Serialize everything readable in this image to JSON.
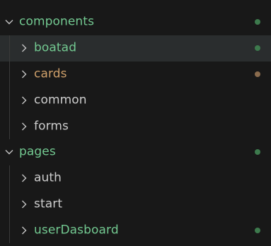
{
  "colors": {
    "background": "#181818",
    "selected_row": "#2a2d2e",
    "folder_green": "#73c991",
    "folder_default": "#cccccc",
    "dot_green": "#3d7a4d",
    "dot_brown": "#8a6b4d",
    "chevron": "#c5c5c5",
    "guide": "#3a3a3a"
  },
  "icons": {
    "expanded": "chevron-down-icon",
    "collapsed": "chevron-right-icon"
  },
  "tree": {
    "components": {
      "label": "components",
      "expanded": true
    },
    "boatad": {
      "label": "boatad",
      "expanded": false,
      "selected": true
    },
    "cards": {
      "label": "cards",
      "expanded": false
    },
    "common": {
      "label": "common",
      "expanded": false
    },
    "forms": {
      "label": "forms",
      "expanded": false
    },
    "pages": {
      "label": "pages",
      "expanded": true
    },
    "auth": {
      "label": "auth",
      "expanded": false
    },
    "start": {
      "label": "start",
      "expanded": false
    },
    "userDasboard": {
      "label": "userDasboard",
      "expanded": false
    }
  }
}
